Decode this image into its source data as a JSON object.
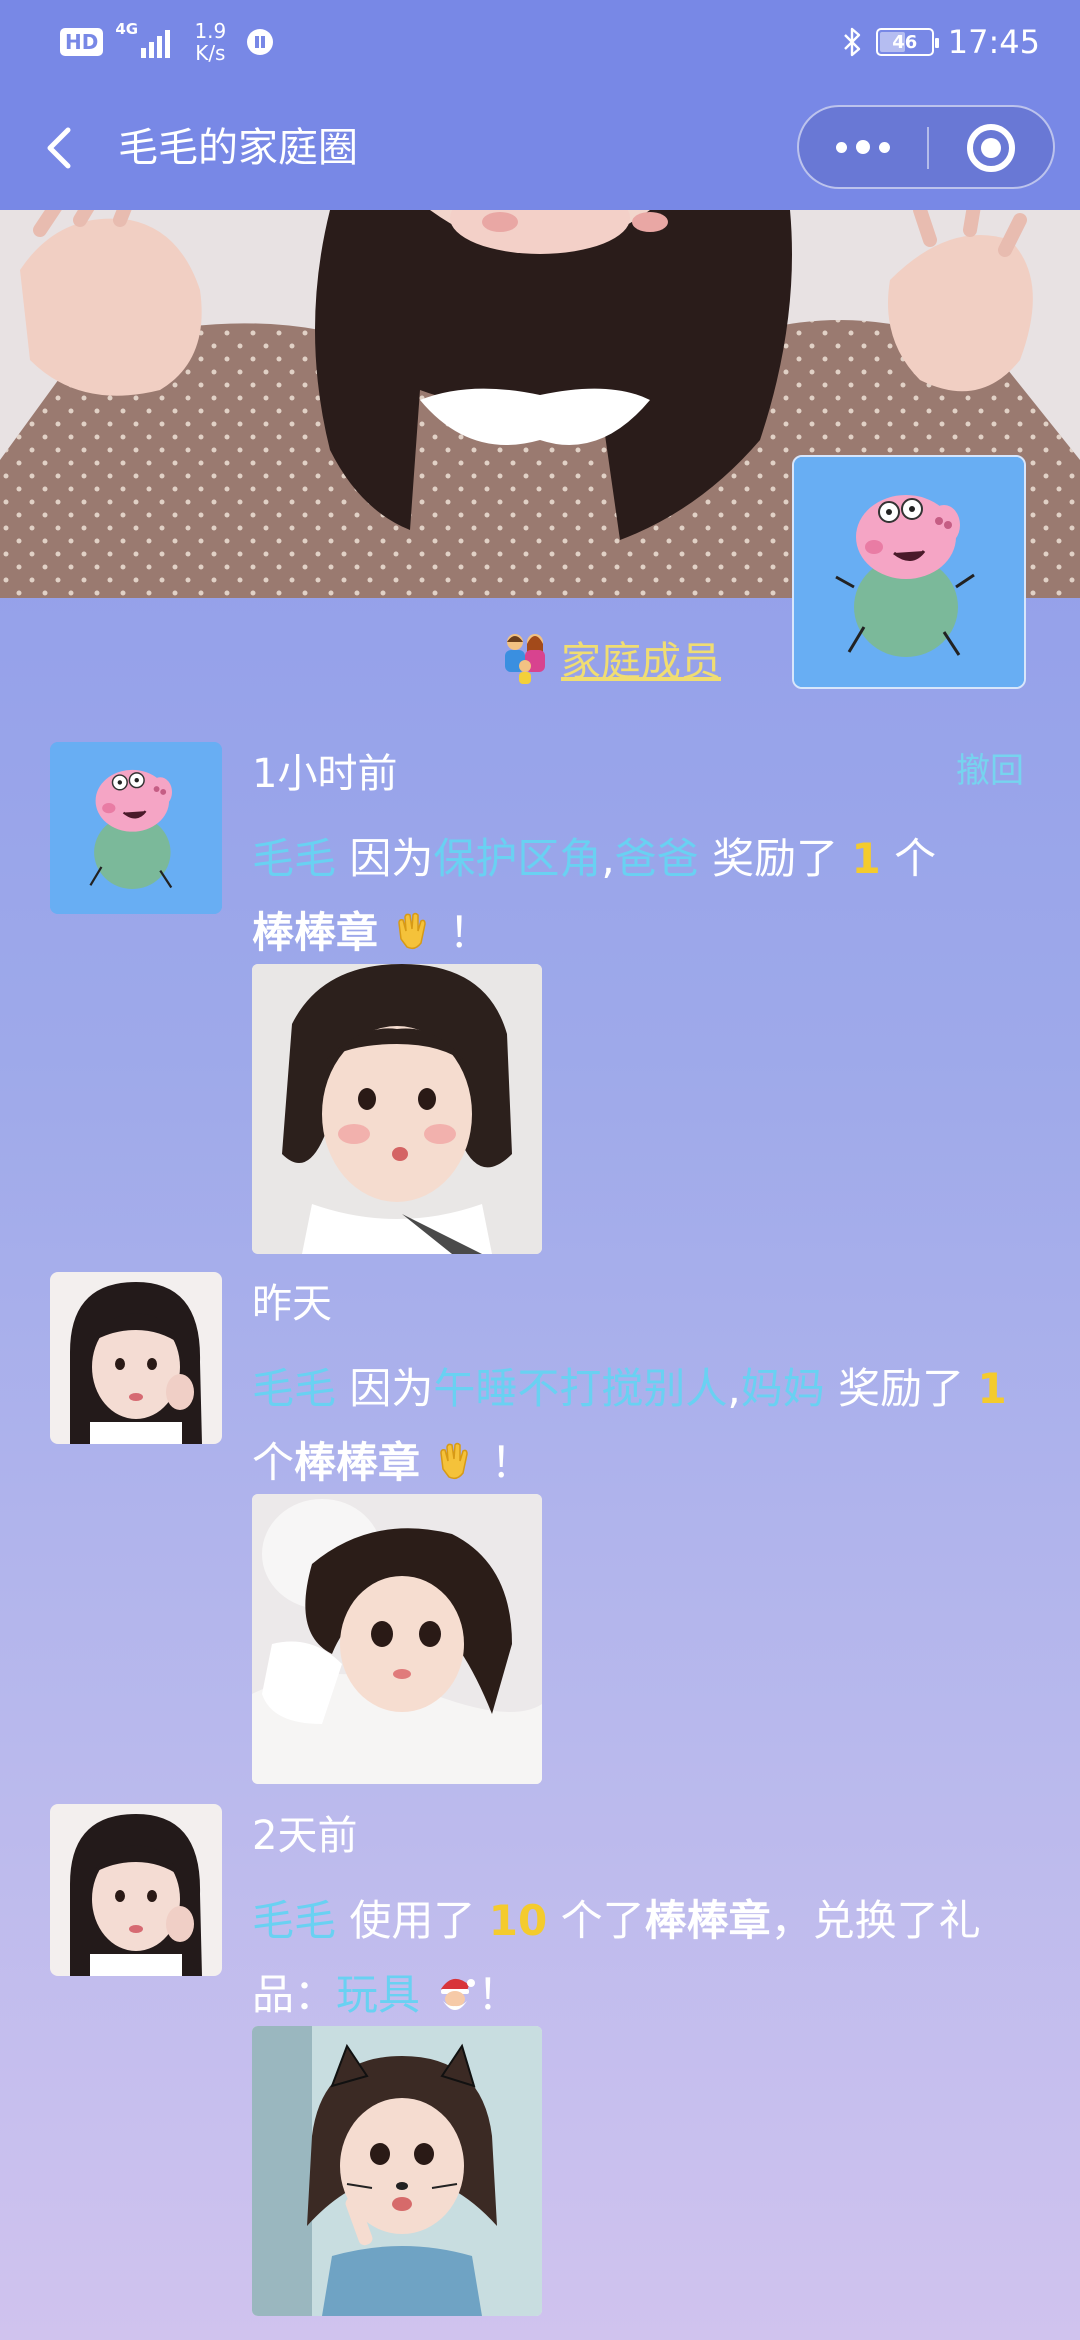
{
  "status_bar": {
    "hd": "HD",
    "network": "4G",
    "speed_value": "1.9",
    "speed_unit": "K/s",
    "battery": "46",
    "battery_level": 0.46,
    "time": "17:45"
  },
  "nav": {
    "title": "毛毛的家庭圈"
  },
  "header": {
    "family_members_label": "家庭成员"
  },
  "feed": [
    {
      "time": "1小时前",
      "revoke": "撤回",
      "child": "毛毛",
      "because": "因为",
      "reason": "保护区角",
      "comma": ",",
      "giver": "爸爸",
      "action": "奖励了",
      "count": "1",
      "unit": "个",
      "badge": "棒棒章",
      "exclaim": "！"
    },
    {
      "time": "昨天",
      "child": "毛毛",
      "because": "因为",
      "reason": "午睡不打搅别人",
      "comma": ",",
      "giver": "妈妈",
      "action": "奖励了",
      "count": "1",
      "unit": "个",
      "badge": "棒棒章",
      "exclaim": "！"
    },
    {
      "time": "2天前",
      "child": "毛毛",
      "action": "使用了",
      "count": "10",
      "unit": "个了",
      "badge": "棒棒章",
      "middle": "，兑换了礼品：",
      "gift": "玩具",
      "exclaim": "！"
    }
  ],
  "icons": {
    "back": "chevron-left-icon",
    "menu": "more-dots-icon",
    "close": "target-icon",
    "family": "family-icon",
    "clap": "clapping-hands-icon",
    "santa": "santa-icon"
  },
  "colors": {
    "header_bg": "#7888e6",
    "highlight_blue": "#69d1f2",
    "highlight_yellow": "#f4cb2d",
    "family_link": "#f0dd72"
  }
}
